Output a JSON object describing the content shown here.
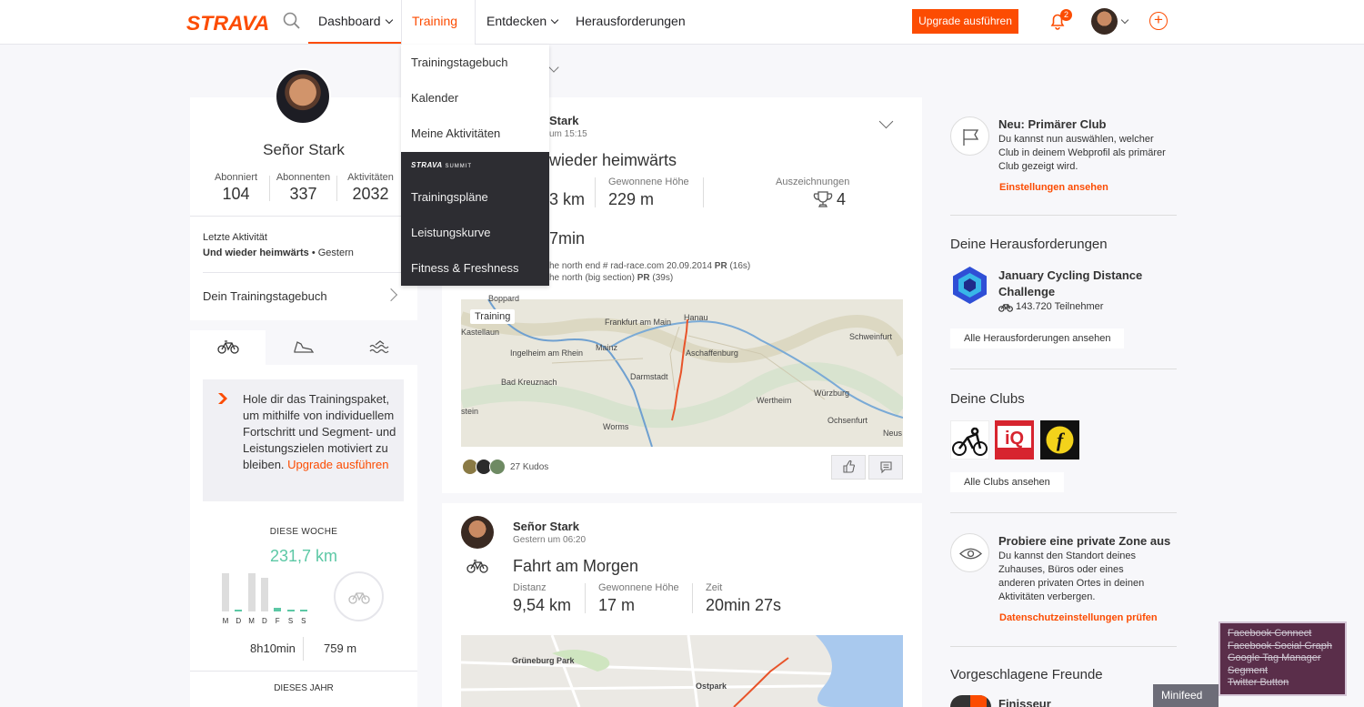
{
  "header": {
    "logo": "STRAVA",
    "nav": {
      "dashboard": "Dashboard",
      "training": "Training",
      "entdecken": "Entdecken",
      "herausforderungen": "Herausforderungen"
    },
    "upgrade_label": "Upgrade ausführen",
    "notification_count": "2"
  },
  "training_menu": {
    "items": [
      "Trainingstagebuch",
      "Kalender",
      "Meine Aktivitäten"
    ],
    "summit_label": "STRAVA",
    "summit_sub": "SUMMIT",
    "summit_items": [
      "Trainingspläne",
      "Leistungskurve",
      "Fitness & Freshness"
    ]
  },
  "profile": {
    "name": "Señor Stark",
    "stats": [
      {
        "label": "Abonniert",
        "value": "104"
      },
      {
        "label": "Abonnenten",
        "value": "337"
      },
      {
        "label": "Aktivitäten",
        "value": "2032"
      }
    ],
    "last_activity_label": "Letzte Aktivität",
    "last_activity_name": "Und wieder heimwärts",
    "last_activity_when": " • Gestern",
    "diary_link": "Dein Trainingstagebuch"
  },
  "training_widget": {
    "promo_text": "Hole dir das Trainingspaket, um mithilfe von individuellem Fortschritt und Segment- und Leistungszielen motiviert zu bleiben.",
    "promo_link": "Upgrade ausführen",
    "week_label": "DIESE WOCHE",
    "week_distance": "231,7 km",
    "days": [
      "M",
      "D",
      "M",
      "D",
      "F",
      "S",
      "S"
    ],
    "day_levels": [
      0.95,
      0.05,
      0.95,
      0.85,
      0.08,
      0.05,
      0.05
    ],
    "time": "8h10min",
    "elevation": "759 m",
    "year_label": "DIESES JAHR"
  },
  "feed": {
    "a1": {
      "athlete": "Stark",
      "time": "um 15:15",
      "title": "wieder heimwärts",
      "distance": "3 km",
      "elev_label": "Gewonnene Höhe",
      "elev": "229 m",
      "awards_label": "Auszeichnungen",
      "awards": "4",
      "time_value": "7min",
      "seg1_pre": "he north end # rad-race.com 20.09.2014 ",
      "seg1_pr": "PR",
      "seg1_post": " (16s)",
      "seg2_pre": "he north (big section) ",
      "seg2_pr": "PR",
      "seg2_post": " (39s)",
      "map_tag": "Training",
      "map_labels": [
        "Boppard",
        "Frankfurt am Main",
        "Hanau",
        "Kastellaun",
        "Ingelheim am Rhein",
        "Mainz",
        "Aschaffenburg",
        "Schweinfurt",
        "Bad Kreuznach",
        "Darmstadt",
        "Wertheim",
        "Würzburg",
        "Ochsenfurt",
        "Worms",
        "stein",
        "Neus"
      ],
      "kudos": "27 Kudos"
    },
    "a2": {
      "athlete": "Señor Stark",
      "time": "Gestern um 06:20",
      "title": "Fahrt am Morgen",
      "dist_label": "Distanz",
      "distance": "9,54 km",
      "elev_label": "Gewonnene Höhe",
      "elev": "17 m",
      "time_label": "Zeit",
      "time_value": "20min 27s",
      "map_labels": [
        "Grüneburg Park",
        "Ostpark"
      ]
    }
  },
  "right": {
    "club_title": "Neu: Primärer Club",
    "club_text": "Du kannst nun auswählen, welcher Club in deinem Webprofil als primärer Club gezeigt wird.",
    "club_link": "Einstellungen ansehen",
    "challenges_heading": "Deine Herausforderungen",
    "challenge_name": "January Cycling Distance Challenge",
    "challenge_participants": "143.720 Teilnehmer",
    "challenges_button": "Alle Herausforderungen ansehen",
    "clubs_heading": "Deine Clubs",
    "clubs_button": "Alle Clubs ansehen",
    "privacy_title": "Probiere eine private Zone aus",
    "privacy_text": "Du kannst den Standort deines Zuhauses, Büros oder eines anderen privaten Ortes in deinen Aktivitäten verbergen.",
    "privacy_link": "Datenschutzeinstellungen prüfen",
    "friends_heading": "Vorgeschlagene Freunde",
    "friend_name": "Finisseur"
  },
  "minifeed": "Minifeed",
  "blocked_trackers": [
    "Facebook Connect",
    "Facebook Social Graph",
    "Google Tag Manager",
    "Segment",
    "Twitter Button"
  ],
  "colors": {
    "brand": "#fc4c02",
    "week_accent": "#5cc8a5"
  }
}
